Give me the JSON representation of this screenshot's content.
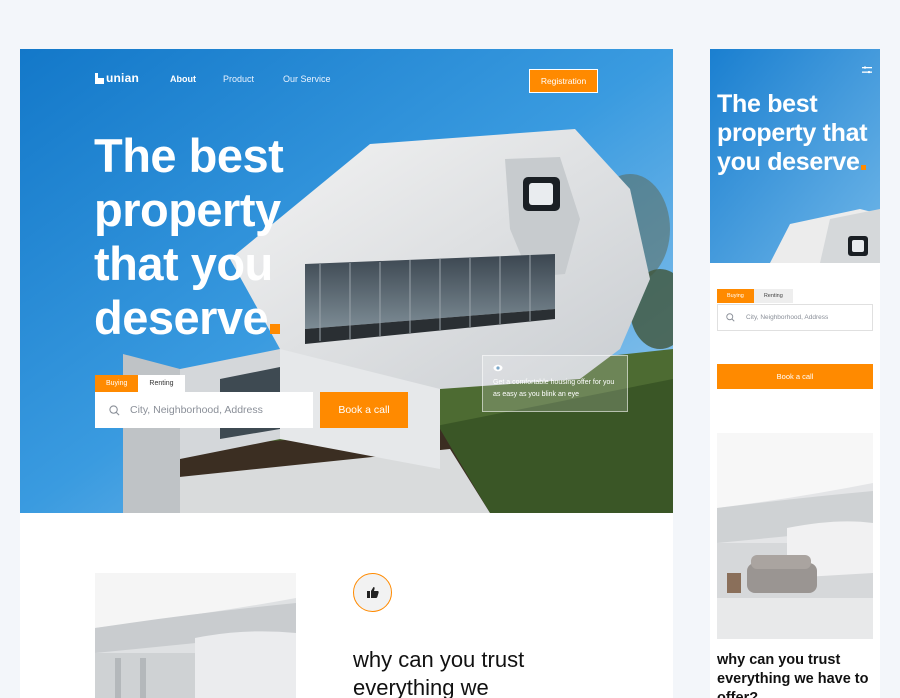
{
  "brand": {
    "name": "unian",
    "accent": "#ff8a00",
    "hero_blue": "#1f88d8"
  },
  "nav": {
    "items": [
      {
        "label": "About"
      },
      {
        "label": "Product"
      },
      {
        "label": "Our Service"
      }
    ],
    "register_label": "Registration"
  },
  "hero": {
    "title": "The best property that you deserve",
    "tabs": [
      "Buying",
      "Renting"
    ],
    "search_placeholder": "City, Neighborhood, Address",
    "book_label": "Book a call",
    "info_card": {
      "icon": "eye-icon",
      "text": "Get a comfortable housing offer for you as easy as you blink an eye"
    }
  },
  "trust": {
    "icon": "thumbs-up-icon",
    "title": "why can you trust everything we",
    "mobile_title": "why can you trust everything we have to offer?"
  },
  "mobile": {
    "menu_icon": "menu-icon"
  }
}
